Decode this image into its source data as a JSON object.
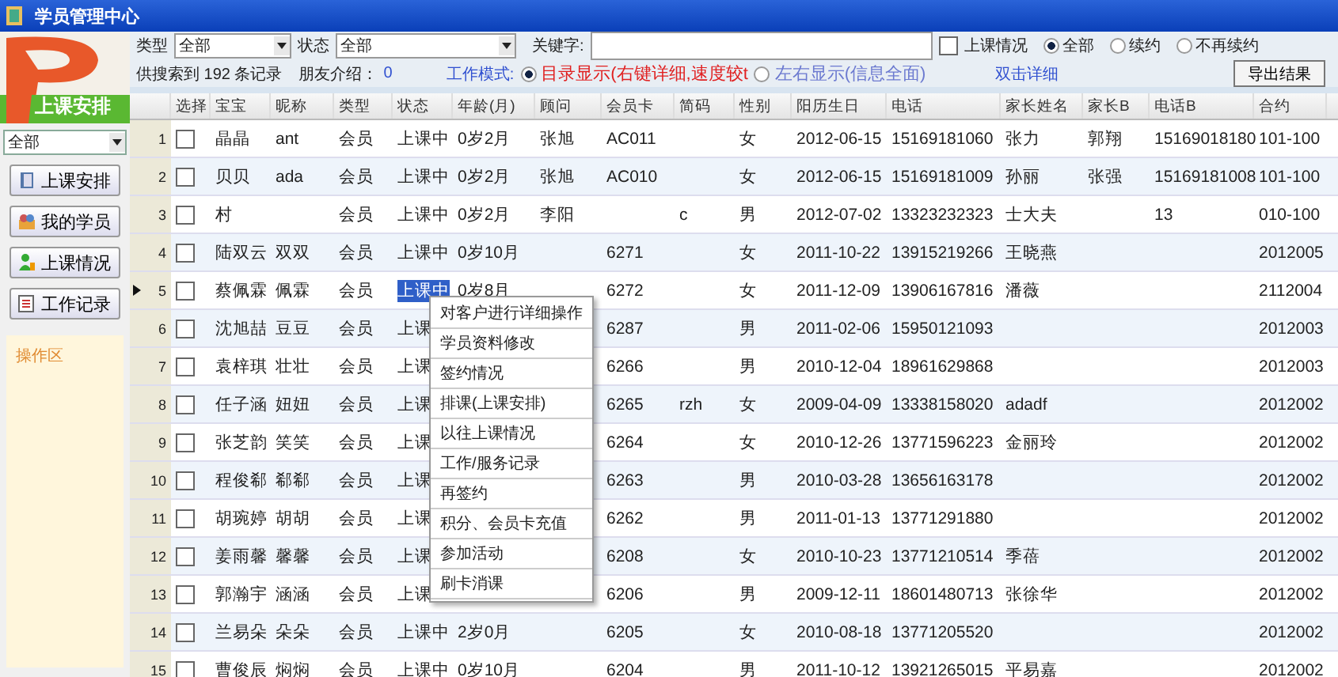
{
  "window": {
    "title": "学员管理中心"
  },
  "sidebar": {
    "logo_text": "上课安排",
    "filter": "全部",
    "buttons": [
      {
        "label": "上课安排"
      },
      {
        "label": "我的学员"
      },
      {
        "label": "上课情况"
      },
      {
        "label": "工作记录"
      }
    ],
    "panel_title": "操作区"
  },
  "toolbar": {
    "type_filter": {
      "label": "类型",
      "value": "全部"
    },
    "status_filter": {
      "label": "状态",
      "value": "全部"
    },
    "keyword": {
      "label": "关键字:"
    },
    "class_check": {
      "label": "上课情况",
      "checked": false
    },
    "renew": [
      {
        "label": "全部",
        "selected": true
      },
      {
        "label": "续约",
        "selected": false
      },
      {
        "label": "不再续约",
        "selected": false
      }
    ]
  },
  "info_bar": {
    "found": "供搜索到 192 条记录",
    "referral_label": "朋友介绍：",
    "referral_count": "0",
    "mode_label": "工作模式:",
    "modes": [
      {
        "label": "目录显示(右键详细,速度较t",
        "selected": true
      },
      {
        "label": "左右显示(信息全面)",
        "selected": false
      }
    ],
    "hint": "双击详细",
    "export_button": "导出结果"
  },
  "table": {
    "columns": [
      "选择",
      "宝宝",
      "昵称",
      "类型",
      "状态",
      "年龄(月)",
      "顾问",
      "会员卡",
      "简码",
      "性别",
      "阳历生日",
      "电话",
      "家长姓名",
      "家长B",
      "电话B",
      "合约"
    ],
    "rows": [
      {
        "number": "1",
        "current": false,
        "selected": false,
        "cells": [
          {
            "kind": "checkbox",
            "checked": false
          },
          "晶晶",
          "ant",
          "会员",
          "上课中",
          "0岁2月",
          "张旭",
          "AC011",
          null,
          "女",
          "2012-06-15",
          "15169181060",
          "张力",
          "郭翔",
          "15169018180",
          "101-100"
        ]
      },
      {
        "number": "2",
        "current": false,
        "selected": false,
        "cells": [
          {
            "kind": "checkbox",
            "checked": false
          },
          "贝贝",
          "ada",
          "会员",
          "上课中",
          "0岁2月",
          "张旭",
          "AC010",
          null,
          "女",
          "2012-06-15",
          "15169181009",
          "孙丽",
          "张强",
          "15169181008",
          "101-100"
        ]
      },
      {
        "number": "3",
        "current": false,
        "selected": false,
        "cells": [
          {
            "kind": "checkbox",
            "checked": false
          },
          "村",
          null,
          "会员",
          "上课中",
          "0岁2月",
          "李阳",
          null,
          "c",
          "男",
          "2012-07-02",
          "13323232323",
          "士大夫",
          null,
          "13",
          "010-100"
        ]
      },
      {
        "number": "4",
        "current": false,
        "selected": false,
        "cells": [
          {
            "kind": "checkbox",
            "checked": false
          },
          "陆双云",
          "双双",
          "会员",
          "上课中",
          "0岁10月",
          null,
          "6271",
          null,
          "女",
          "2011-10-22",
          "13915219266",
          "王晓燕",
          null,
          null,
          "2012005"
        ]
      },
      {
        "number": "5",
        "current": true,
        "selected": true,
        "cells": [
          {
            "kind": "checkbox",
            "checked": false
          },
          "蔡佩霖",
          "佩霖",
          "会员",
          "上课中",
          "0岁8月",
          null,
          "6272",
          null,
          "女",
          "2011-12-09",
          "13906167816",
          "潘薇",
          null,
          null,
          "2112004"
        ]
      },
      {
        "number": "6",
        "current": false,
        "selected": false,
        "cells": [
          {
            "kind": "checkbox",
            "checked": false
          },
          "沈旭喆",
          "豆豆",
          "会员",
          "上课",
          null,
          null,
          "6287",
          null,
          "男",
          "2011-02-06",
          "15950121093",
          null,
          null,
          null,
          "2012003"
        ]
      },
      {
        "number": "7",
        "current": false,
        "selected": false,
        "cells": [
          {
            "kind": "checkbox",
            "checked": false
          },
          "袁梓琪",
          "壮壮",
          "会员",
          "上课",
          null,
          null,
          "6266",
          null,
          "男",
          "2010-12-04",
          "18961629868",
          null,
          null,
          null,
          "2012003"
        ]
      },
      {
        "number": "8",
        "current": false,
        "selected": false,
        "cells": [
          {
            "kind": "checkbox",
            "checked": false
          },
          "任子涵",
          "妞妞",
          "会员",
          "上课",
          null,
          null,
          "6265",
          "rzh",
          "女",
          "2009-04-09",
          "13338158020",
          "adadf",
          null,
          null,
          "2012002"
        ]
      },
      {
        "number": "9",
        "current": false,
        "selected": false,
        "cells": [
          {
            "kind": "checkbox",
            "checked": false
          },
          "张芝韵",
          "笑笑",
          "会员",
          "上课",
          null,
          null,
          "6264",
          null,
          "女",
          "2010-12-26",
          "13771596223",
          "金丽玲",
          null,
          null,
          "2012002"
        ]
      },
      {
        "number": "10",
        "current": false,
        "selected": false,
        "cells": [
          {
            "kind": "checkbox",
            "checked": false
          },
          "程俊郗",
          "郗郗",
          "会员",
          "上课",
          null,
          null,
          "6263",
          null,
          "男",
          "2010-03-28",
          "13656163178",
          null,
          null,
          null,
          "2012002"
        ]
      },
      {
        "number": "11",
        "current": false,
        "selected": false,
        "cells": [
          {
            "kind": "checkbox",
            "checked": false
          },
          "胡琬婷",
          "胡胡",
          "会员",
          "上课",
          null,
          null,
          "6262",
          null,
          "男",
          "2011-01-13",
          "13771291880",
          null,
          null,
          null,
          "2012002"
        ]
      },
      {
        "number": "12",
        "current": false,
        "selected": false,
        "cells": [
          {
            "kind": "checkbox",
            "checked": false
          },
          "姜雨馨",
          "馨馨",
          "会员",
          "上课",
          null,
          null,
          "6208",
          null,
          "女",
          "2010-10-23",
          "13771210514",
          "季蓓",
          null,
          null,
          "2012002"
        ]
      },
      {
        "number": "13",
        "current": false,
        "selected": false,
        "cells": [
          {
            "kind": "checkbox",
            "checked": false
          },
          "郭瀚宇",
          "涵涵",
          "会员",
          "上课",
          null,
          null,
          "6206",
          null,
          "男",
          "2009-12-11",
          "18601480713",
          "张徐华",
          null,
          null,
          "2012002"
        ]
      },
      {
        "number": "14",
        "current": false,
        "selected": false,
        "cells": [
          {
            "kind": "checkbox",
            "checked": false
          },
          "兰易朵",
          "朵朵",
          "会员",
          "上课中",
          "2岁0月",
          null,
          "6205",
          null,
          "女",
          "2010-08-18",
          "13771205520",
          null,
          null,
          null,
          "2012002"
        ]
      },
      {
        "number": "15",
        "current": false,
        "selected": false,
        "cells": [
          {
            "kind": "checkbox",
            "checked": false
          },
          "曹俊辰",
          "焖焖",
          "会员",
          "上课中",
          "0岁10月",
          null,
          "6204",
          null,
          "男",
          "2011-10-12",
          "13921265015",
          "平易嘉",
          null,
          null,
          "2012002"
        ]
      }
    ]
  },
  "context_menu": {
    "items": [
      "对客户进行详细操作",
      "学员资料修改",
      "签约情况",
      "排课(上课安排)",
      "以往上课情况",
      "工作/服务记录",
      "再签约",
      "积分、会员卡充值",
      "参加活动",
      "刷卡消课"
    ]
  }
}
